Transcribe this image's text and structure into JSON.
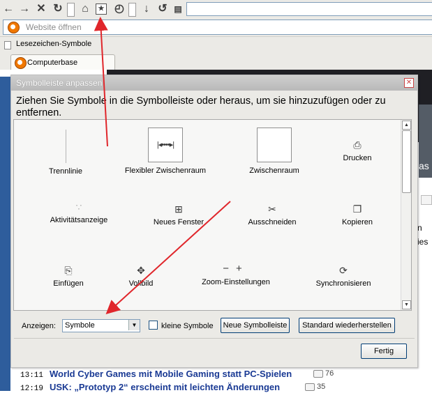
{
  "browser": {
    "toolbar": {
      "buttons": [
        "back-icon",
        "forward-icon",
        "stop-icon",
        "reload-icon",
        "home-icon",
        "bookmark-star-icon",
        "history-clock-icon",
        "download-icon",
        "sync-icon",
        "page-icon"
      ]
    },
    "address": {
      "placeholder": "Website öffnen"
    },
    "bookmarks_toolbar": {
      "item": "Lesezeichen-Symbole"
    },
    "tab": {
      "label": "Computerbase"
    }
  },
  "dialog": {
    "title": "Symbolleiste anpassen",
    "instruction": "Ziehen Sie Symbole in die Symbolleiste oder heraus, um sie hinzuzufügen oder zu entfernen.",
    "items": {
      "trennlinie": "Trennlinie",
      "flex": "Flexibler Zwischenraum",
      "space": "Zwischenraum",
      "print": "Drucken",
      "activity": "Aktivitätsanzeige",
      "new_window": "Neues Fenster",
      "cut": "Ausschneiden",
      "copy": "Kopieren",
      "paste": "Einfügen",
      "fullscreen": "Vollbild",
      "zoom": "Zoom-Einstellungen",
      "sync": "Synchronisieren"
    },
    "show_label": "Anzeigen:",
    "show_value": "Symbole",
    "small_icons_label": "kleine Symbole",
    "small_icons_checked": false,
    "new_toolbar": "Neue Symbolleiste",
    "restore_default": "Standard wiederherstellen",
    "done": "Fertig"
  },
  "page": {
    "side_fragments": [
      "as",
      "n",
      "ies"
    ],
    "news": [
      {
        "time": "13:11",
        "title": "World Cyber Games mit Mobile Gaming statt PC-Spielen",
        "comments": "76"
      },
      {
        "time": "12:19",
        "title": "USK: „Prototyp 2“ erscheint mit leichten Änderungen",
        "comments": "35"
      }
    ]
  },
  "colors": {
    "annotation_arrow": "#e0262b",
    "link": "#1a3a94"
  }
}
